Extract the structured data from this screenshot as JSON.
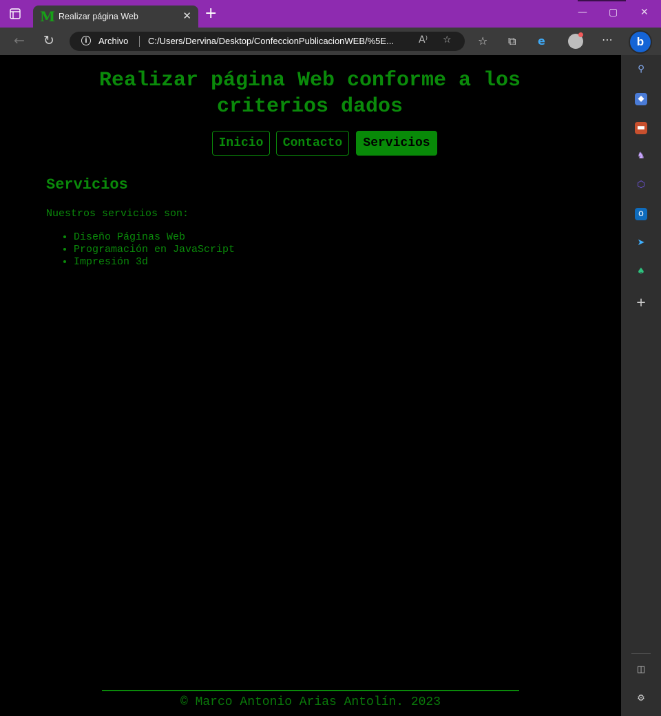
{
  "browser": {
    "tab_title": "Realizar página Web",
    "tab_favicon": "M",
    "close_tab": "✕",
    "new_tab": "+",
    "address": {
      "label": "Archivo",
      "url": "C:/Users/Dervina/Desktop/ConfeccionPublicacionWEB/%5E..."
    },
    "bing_label": "b",
    "colors": {
      "titlebar": "#8e2bb0",
      "toolbar": "#3b3b3b",
      "sidebar": "#2f2f2f"
    }
  },
  "page": {
    "title": "Realizar página Web conforme a los criterios dados",
    "nav": [
      {
        "label": "Inicio",
        "active": false
      },
      {
        "label": "Contacto",
        "active": false
      },
      {
        "label": "Servicios",
        "active": true
      }
    ],
    "section_title": "Servicios",
    "intro": "Nuestros servicios son:",
    "services": [
      "Diseño Páginas Web",
      "Programación en JavaScript",
      "Impresión 3d"
    ],
    "footer": "Marco Antonio Arias Antolín. 2023",
    "footer_symbol": "©",
    "colors": {
      "text": "#0a8a0a",
      "background": "#000000"
    }
  }
}
